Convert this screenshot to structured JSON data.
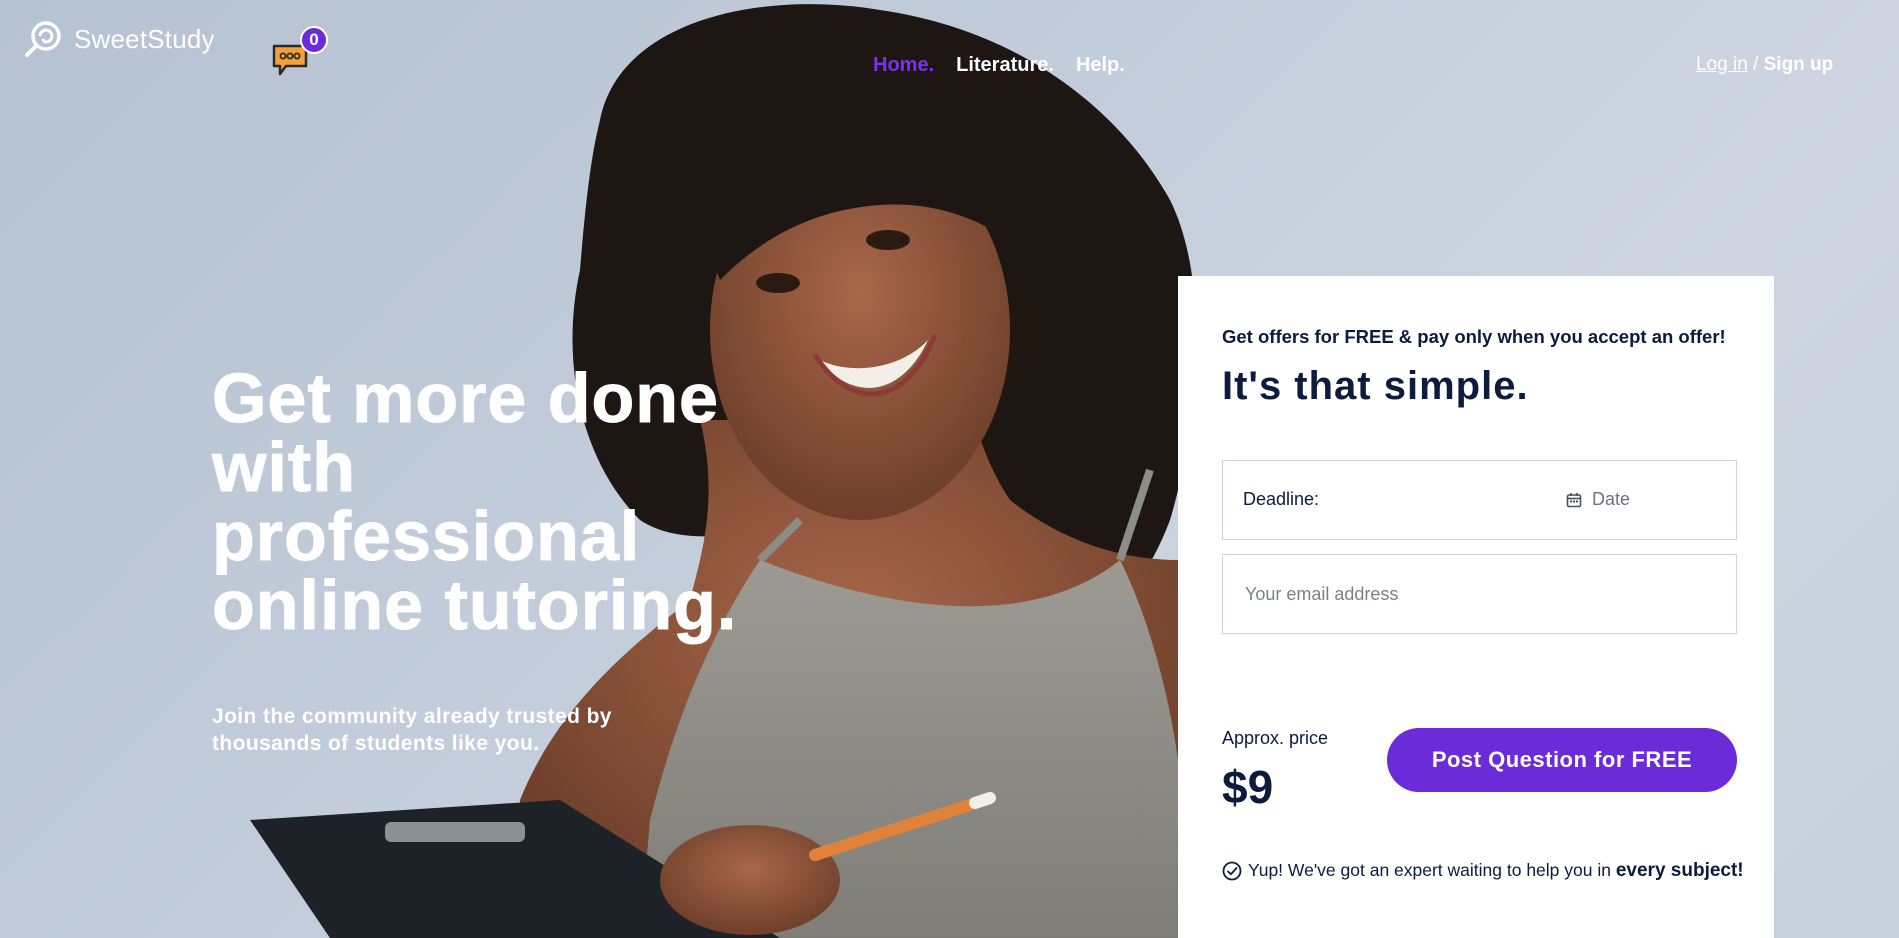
{
  "brand": {
    "name": "SweetStudy"
  },
  "chat": {
    "count": "0"
  },
  "nav": {
    "items": [
      {
        "label": "Home."
      },
      {
        "label": "Literature."
      },
      {
        "label": "Help."
      }
    ]
  },
  "auth": {
    "login": "Log in",
    "separator": " / ",
    "signup": "Sign up"
  },
  "hero": {
    "headline": "Get more done with professional online tutoring.",
    "subline": "Join the community already trusted by thousands of students like you."
  },
  "form": {
    "offer_text": "Get offers for FREE & pay only when you accept an offer!",
    "title": "It's that simple.",
    "deadline_label": "Deadline:",
    "date_placeholder": "Date",
    "email_placeholder": "Your email address",
    "price_label": "Approx. price",
    "price_value": "$9",
    "submit_label": "Post Question for FREE",
    "note_text": "Yup! We've got an expert waiting to help you in ",
    "note_emphasis": "every subject!"
  },
  "colors": {
    "accent": "#6c2bd9",
    "active_nav": "#7b2ff0",
    "navy": "#0d1b3e"
  }
}
